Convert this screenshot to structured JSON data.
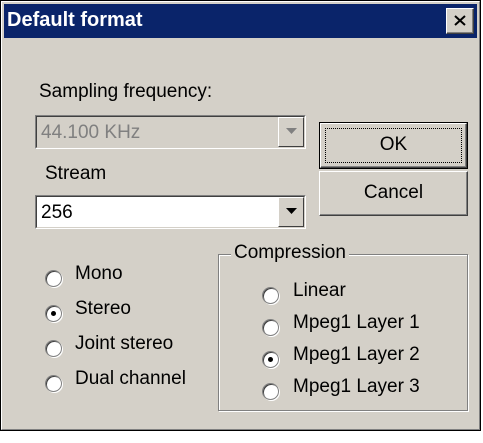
{
  "window": {
    "title": "Default format"
  },
  "sampling": {
    "label": "Sampling frequency:",
    "value": "44.100 KHz",
    "enabled": false
  },
  "stream": {
    "label": "Stream",
    "value": "256"
  },
  "buttons": {
    "ok": "OK",
    "cancel": "Cancel"
  },
  "channel_modes": [
    {
      "label": "Mono",
      "selected": false
    },
    {
      "label": "Stereo",
      "selected": true
    },
    {
      "label": "Joint stereo",
      "selected": false
    },
    {
      "label": "Dual channel",
      "selected": false
    }
  ],
  "compression": {
    "title": "Compression",
    "options": [
      {
        "label": "Linear",
        "selected": false
      },
      {
        "label": "Mpeg1 Layer 1",
        "selected": false
      },
      {
        "label": "Mpeg1 Layer 2",
        "selected": true
      },
      {
        "label": "Mpeg1 Layer 3",
        "selected": false
      }
    ]
  },
  "colors": {
    "title_bar": "#0a246a",
    "dialog_face": "#d4d0c8",
    "disabled_text": "#808080"
  }
}
